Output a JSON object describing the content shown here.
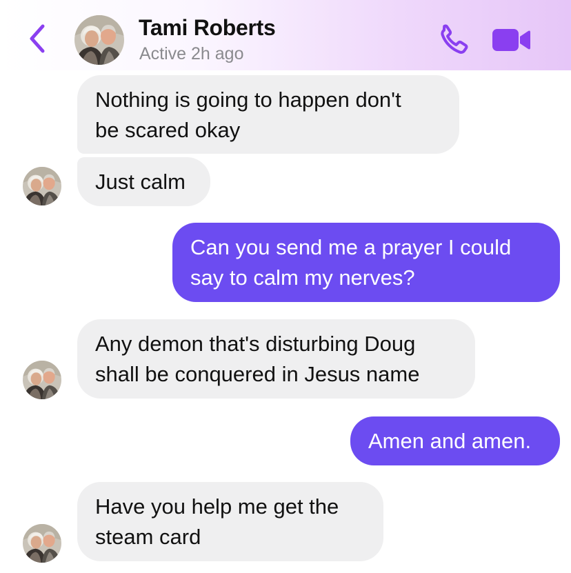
{
  "header": {
    "contact_name": "Tami Roberts",
    "status": "Active 2h ago",
    "icons": {
      "back": "chevron-left-icon",
      "call": "phone-icon",
      "video": "video-camera-icon"
    },
    "accent_color": "#8a3ff0"
  },
  "messages": [
    {
      "direction": "incoming",
      "lines": [
        "Nothing is going to happen don't",
        "be scared okay"
      ]
    },
    {
      "direction": "incoming",
      "lines": [
        "Just calm"
      ]
    },
    {
      "direction": "outgoing",
      "lines": [
        "Can you send me a prayer I could",
        "say to calm my nerves?"
      ]
    },
    {
      "direction": "incoming",
      "lines": [
        "Any demon that's disturbing Doug",
        "shall be conquered in Jesus name"
      ]
    },
    {
      "direction": "outgoing",
      "lines": [
        "Amen and amen."
      ]
    },
    {
      "direction": "incoming",
      "lines": [
        "Have you help me get the",
        "steam card"
      ]
    }
  ],
  "colors": {
    "incoming_bubble": "#efeff0",
    "outgoing_bubble": "#6c4cf1",
    "outgoing_text": "#ffffff",
    "incoming_text": "#111111"
  }
}
